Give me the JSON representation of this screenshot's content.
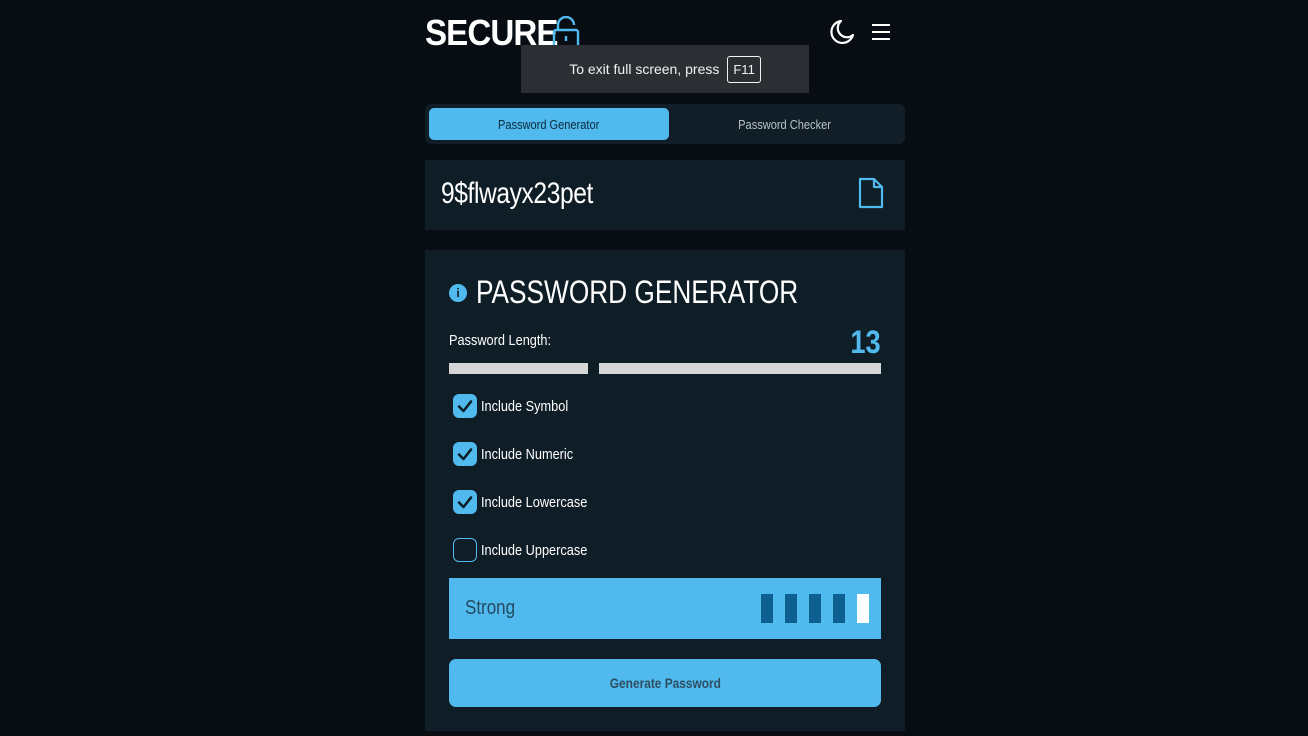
{
  "header": {
    "logo_text": "SECURE",
    "lock_icon": "unlocked-padlock-icon",
    "theme_icon": "moon-icon",
    "menu_icon": "hamburger-menu-icon"
  },
  "toast": {
    "message": "To exit full screen, press",
    "key": "F11"
  },
  "tabs": [
    {
      "label": "Password Generator",
      "active": true
    },
    {
      "label": "Password Checker",
      "active": false
    }
  ],
  "output": {
    "password": "9$flwayx23pet",
    "copy_icon": "document-copy-icon"
  },
  "generator": {
    "title": "PASSWORD GENERATOR",
    "info_glyph": "i",
    "length_label": "Password Length:",
    "length_value": "13",
    "options": [
      {
        "label": "Include Symbol",
        "checked": true
      },
      {
        "label": "Include Numeric",
        "checked": true
      },
      {
        "label": "Include Lowercase",
        "checked": true
      },
      {
        "label": "Include Uppercase",
        "checked": false
      }
    ],
    "strength_label": "Strong",
    "strength_level": 5,
    "generate_label": "Generate Password"
  },
  "colors": {
    "accent": "#50b9ee",
    "background": "#070d12",
    "panel": "#0f1d26",
    "strength_bar": "#0d5f8f"
  }
}
